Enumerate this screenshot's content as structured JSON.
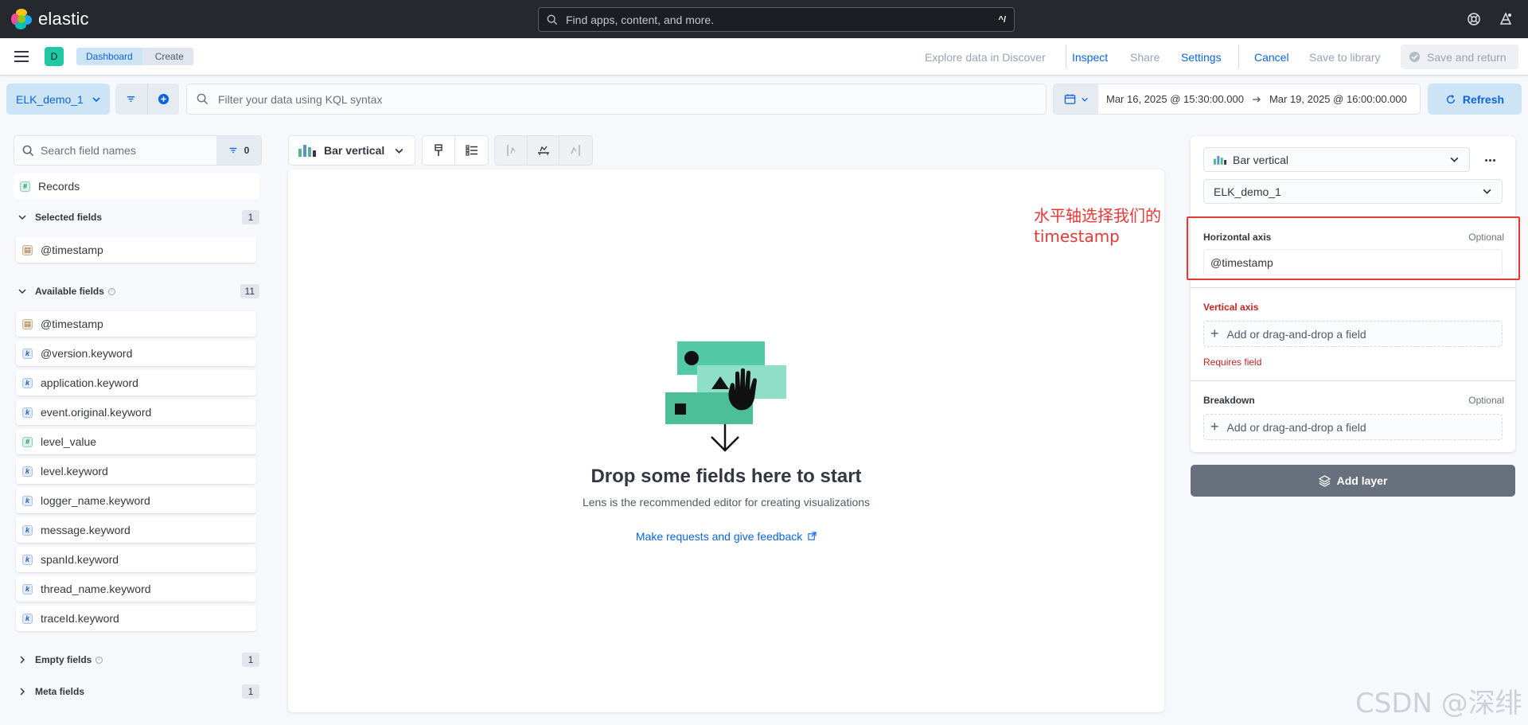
{
  "header": {
    "brand": "elastic",
    "search_placeholder": "Find apps, content, and more.",
    "search_shortcut": "^/"
  },
  "subheader": {
    "space_initial": "D",
    "breadcrumbs": [
      "Dashboard",
      "Create"
    ],
    "links": {
      "explore": "Explore data in Discover",
      "inspect": "Inspect",
      "share": "Share",
      "settings": "Settings",
      "cancel": "Cancel",
      "save_library": "Save to library",
      "save_return": "Save and return"
    }
  },
  "querybar": {
    "data_view": "ELK_demo_1",
    "kql_placeholder": "Filter your data using KQL syntax",
    "date_start": "Mar 16, 2025 @ 15:30:00.000",
    "date_end": "Mar 19, 2025 @ 16:00:00.000",
    "refresh": "Refresh"
  },
  "sidebar": {
    "search_placeholder": "Search field names",
    "filter_count": "0",
    "records_label": "Records",
    "selected": {
      "title": "Selected fields",
      "count": "1",
      "fields": [
        "@timestamp"
      ]
    },
    "available": {
      "title": "Available fields",
      "count": "11",
      "fields": [
        {
          "name": "@timestamp",
          "type": "date"
        },
        {
          "name": "@version.keyword",
          "type": "keyword"
        },
        {
          "name": "application.keyword",
          "type": "keyword"
        },
        {
          "name": "event.original.keyword",
          "type": "keyword"
        },
        {
          "name": "level_value",
          "type": "number"
        },
        {
          "name": "level.keyword",
          "type": "keyword"
        },
        {
          "name": "logger_name.keyword",
          "type": "keyword"
        },
        {
          "name": "message.keyword",
          "type": "keyword"
        },
        {
          "name": "spanId.keyword",
          "type": "keyword"
        },
        {
          "name": "thread_name.keyword",
          "type": "keyword"
        },
        {
          "name": "traceId.keyword",
          "type": "keyword"
        }
      ]
    },
    "empty": {
      "title": "Empty fields",
      "count": "1"
    },
    "meta": {
      "title": "Meta fields",
      "count": "1"
    }
  },
  "workspace": {
    "chart_type": "Bar vertical",
    "drop_title": "Drop some fields here to start",
    "drop_subtitle": "Lens is the recommended editor for creating visualizations",
    "feedback_link": "Make requests and give feedback"
  },
  "config": {
    "chart_type": "Bar vertical",
    "data_view": "ELK_demo_1",
    "horizontal": {
      "label": "Horizontal axis",
      "optional": "Optional",
      "value": "@timestamp"
    },
    "vertical": {
      "label": "Vertical axis",
      "placeholder": "Add or drag-and-drop a field",
      "error": "Requires field"
    },
    "breakdown": {
      "label": "Breakdown",
      "optional": "Optional",
      "placeholder": "Add or drag-and-drop a field"
    },
    "add_layer": "Add layer"
  },
  "annotation": {
    "line1": "水平轴选择我们的",
    "line2": "timestamp"
  },
  "watermark": "CSDN @深绯",
  "colors": {
    "accent": "#0b64dd",
    "header_bg": "#25282f",
    "danger": "#bd271e",
    "annotation": "#e53935"
  }
}
